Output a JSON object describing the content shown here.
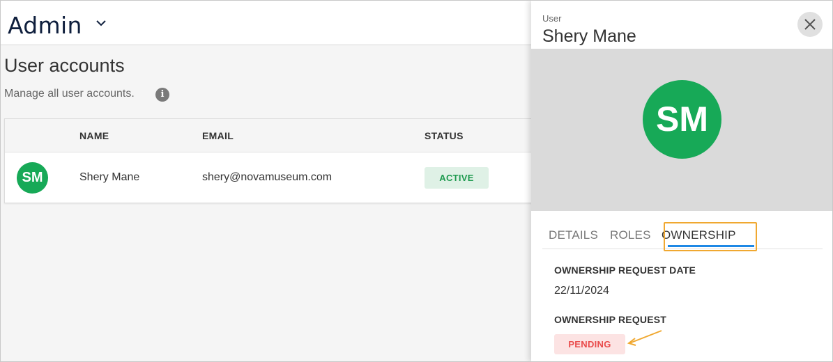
{
  "header": {
    "app_title": "Admin"
  },
  "page": {
    "title": "User accounts",
    "subtitle": "Manage all user accounts."
  },
  "table": {
    "columns": [
      "NAME",
      "EMAIL",
      "STATUS"
    ],
    "rows": [
      {
        "initials": "SM",
        "name": "Shery Mane",
        "email": "shery@novamuseum.com",
        "status": "ACTIVE"
      }
    ]
  },
  "panel": {
    "kicker": "User",
    "name": "Shery Mane",
    "initials": "SM",
    "tabs": [
      "DETAILS",
      "ROLES",
      "OWNERSHIP"
    ],
    "active_tab": "OWNERSHIP",
    "fields": [
      {
        "label": "OWNERSHIP REQUEST DATE",
        "value": "22/11/2024"
      },
      {
        "label": "OWNERSHIP REQUEST",
        "value": "PENDING"
      }
    ]
  },
  "icons": {
    "app_menu": "chevron-down-icon",
    "info": "info-icon",
    "close": "close-icon",
    "annotation": "arrow-icon"
  },
  "colors": {
    "avatar": "#17a957",
    "active_badge_bg": "#dff1e6",
    "active_badge_text": "#1e9a4f",
    "pending_badge_bg": "#fce3e3",
    "pending_badge_text": "#e94b4b",
    "tab_underline": "#1e88e5",
    "highlight": "#f0a830",
    "brand_title": "#0f1f3d"
  }
}
